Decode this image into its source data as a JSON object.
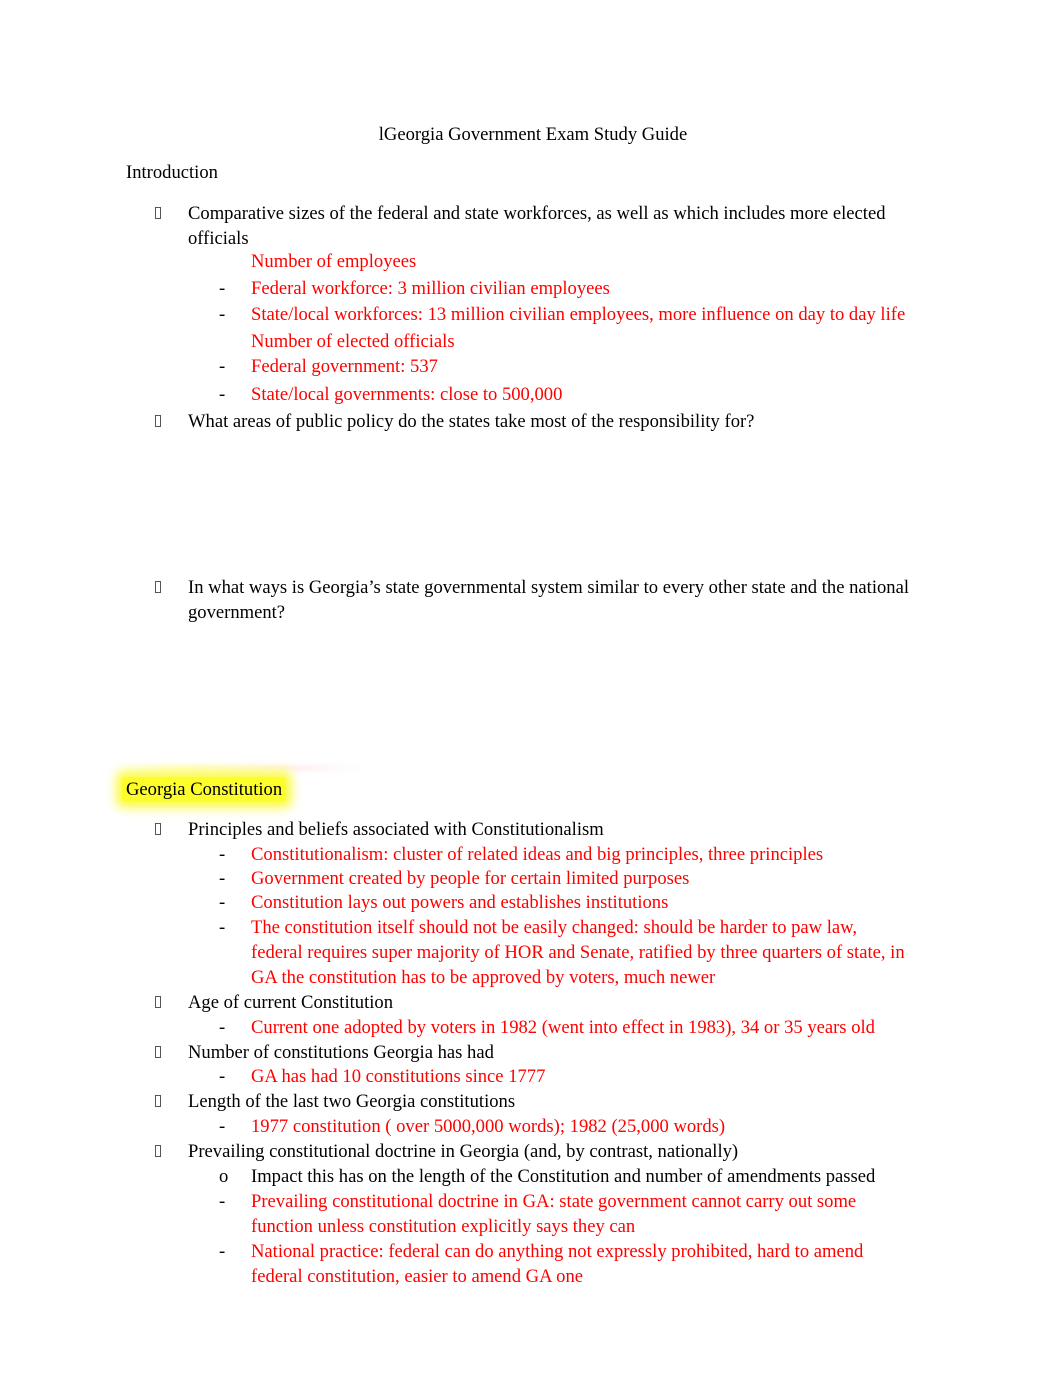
{
  "document": {
    "title": "lGeorgia Government Exam Study Guide",
    "colors": {
      "text": "#000000",
      "answer_text": "#ff0000",
      "highlight": "#fdfd2c"
    },
    "bullet_icon": "missing-glyph-bullet",
    "sections": [
      {
        "heading": "Introduction",
        "items": [
          {
            "question_lines": [
              "Comparative sizes of the federal and state workforces, as well as which includes more elected",
              "officials"
            ],
            "answers": [
              {
                "marker": "",
                "lines": [
                  "Number of employees"
                ]
              },
              {
                "marker": "-",
                "lines": [
                  "Federal workforce: 3 million civilian employees"
                ]
              },
              {
                "marker": "-",
                "lines": [
                  "State/local workforces: 13 million civilian employees, more influence on day to day life"
                ]
              },
              {
                "marker": "",
                "lines": [
                  "Number of elected officials"
                ]
              },
              {
                "marker": "-",
                "lines": [
                  "Federal government: 537"
                ]
              },
              {
                "marker": "-",
                "lines": [
                  "State/local governments: close to 500,000"
                ]
              }
            ]
          },
          {
            "question_lines": [
              "What areas of public policy do the states take most of the responsibility for?"
            ],
            "answers": []
          },
          {
            "question_lines": [
              "In what ways is Georgia’s state governmental system similar to every other state and the national",
              "government?"
            ],
            "answers": []
          }
        ]
      },
      {
        "heading": "Georgia Constitution",
        "heading_highlighted": true,
        "items": [
          {
            "question_lines": [
              "Principles and beliefs associated with  Constitutionalism"
            ],
            "answers": [
              {
                "marker": "-",
                "lines": [
                  "Constitutionalism:  cluster of related ideas and big principles, three principles"
                ]
              },
              {
                "marker": "-",
                "lines": [
                  "Government created by people for certain limited purposes"
                ]
              },
              {
                "marker": "-",
                "lines": [
                  "Constitution lays out powers and establishes institutions"
                ]
              },
              {
                "marker": "-",
                "lines": [
                  "The constitution itself should not be easily changed:    should be harder to paw law,",
                  "federal requires super majority of HOR and Senate, ratified by three quarters of state, in",
                  "GA the constitution has to be approved by voters, much newer"
                ]
              }
            ]
          },
          {
            "question_lines": [
              "Age of current Constitution"
            ],
            "answers": [
              {
                "marker": "-",
                "lines": [
                  "Current one adopted by voters in 1982 (went into effect in 1983), 34 or 35 years old"
                ]
              }
            ]
          },
          {
            "question_lines": [
              "Number of constitutions Georgia has had"
            ],
            "answers": [
              {
                "marker": "-",
                "lines": [
                  "GA has had 10 constitutions since 1777"
                ]
              }
            ]
          },
          {
            "question_lines": [
              "Length of the last two Georgia constitutions"
            ],
            "answers": [
              {
                "marker": "-",
                "lines": [
                  "1977 constitution ( over 5000,000 words); 1982 (25,000 words)"
                ]
              }
            ]
          },
          {
            "question_lines": [
              "Prevailing constitutional doctrine in Georgia (and, by contrast, nationally)"
            ],
            "sub_question": {
              "marker": "o",
              "text": "Impact this has on the length of the Constitution and number of amendments passed"
            },
            "answers": [
              {
                "marker": "-",
                "lines": [
                  "Prevailing constitutional doctrine in GA:  state government cannot carry out some",
                  "function unless constitution explicitly says they can"
                ]
              },
              {
                "marker": "-",
                "lines": [
                  "National practice:  federal can do anything not expressly prohibited, hard to amend",
                  "federal constitution, easier to amend GA one"
                ]
              }
            ]
          }
        ]
      }
    ]
  }
}
